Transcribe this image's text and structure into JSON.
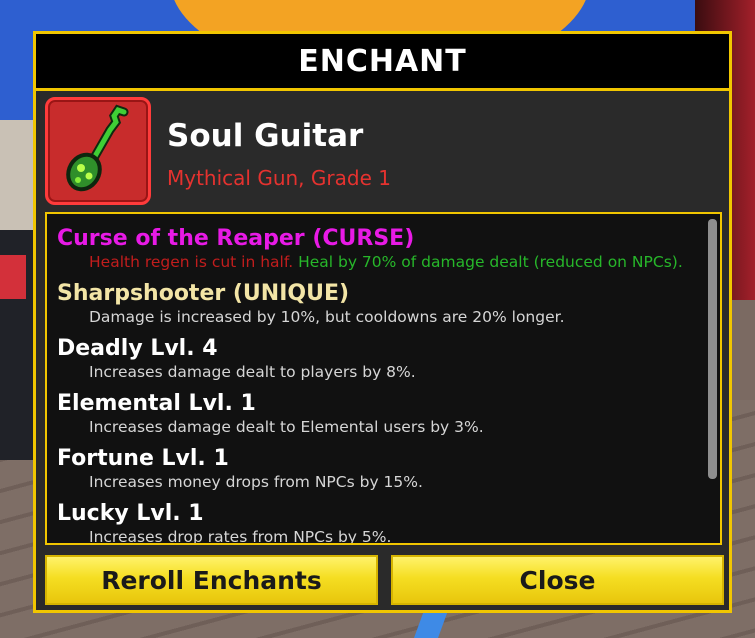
{
  "window": {
    "title": "ENCHANT"
  },
  "item": {
    "name": "Soul Guitar",
    "subtitle": "Mythical Gun, Grade 1",
    "icon": "soul-guitar-icon"
  },
  "enchants": [
    {
      "title": "Curse of the Reaper (CURSE)",
      "desc_negative": "Health regen is cut in half.",
      "desc_positive": "Heal by 70% of damage dealt (reduced on NPCs)."
    },
    {
      "title": "Sharpshooter (UNIQUE)",
      "desc": "Damage is increased by 10%, but cooldowns are 20% longer."
    },
    {
      "title": "Deadly Lvl. 4",
      "desc": "Increases damage dealt to players by 8%."
    },
    {
      "title": "Elemental Lvl. 1",
      "desc": "Increases damage dealt to Elemental users by 3%."
    },
    {
      "title": "Fortune Lvl. 1",
      "desc": "Increases money drops from NPCs by 15%."
    },
    {
      "title": "Lucky Lvl. 1",
      "desc": "Increases drop rates from NPCs by 5%."
    }
  ],
  "buttons": {
    "reroll": "Reroll Enchants",
    "close": "Close"
  },
  "colors": {
    "accent": "#f1c600",
    "curse": "#e81ae6",
    "unique": "#f3e5a6",
    "rarity": "#e5322f",
    "negative": "#c11d1d",
    "positive": "#27b72a"
  }
}
